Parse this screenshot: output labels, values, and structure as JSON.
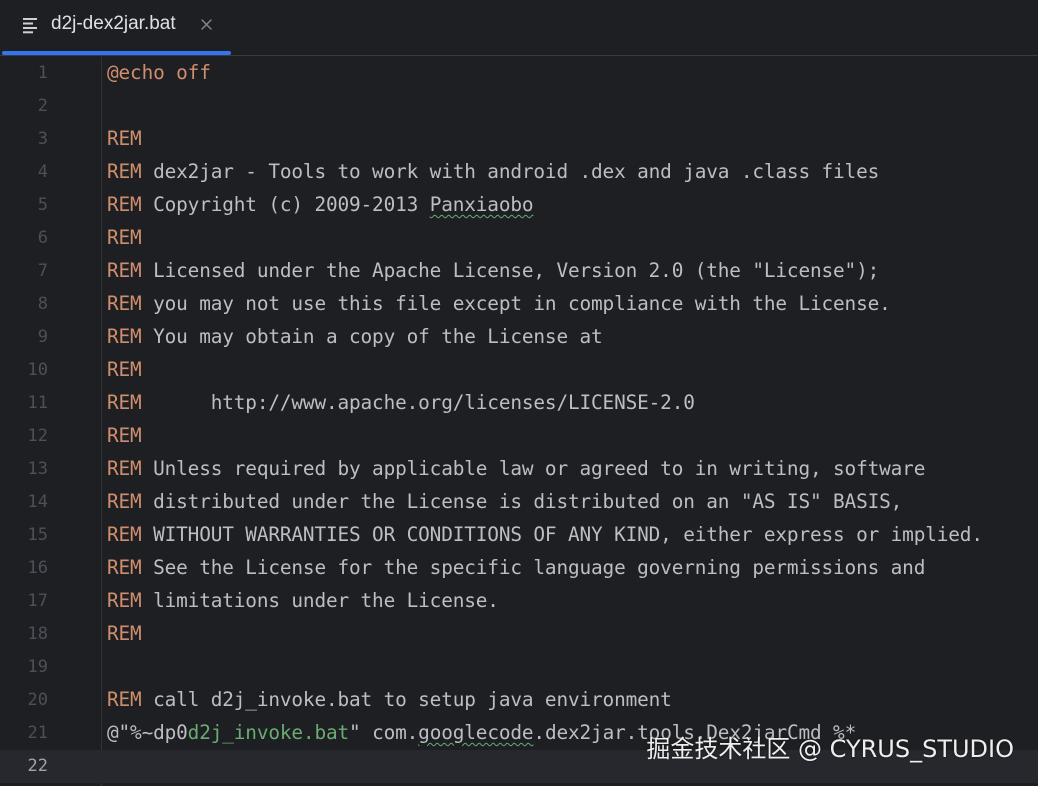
{
  "tab": {
    "label": "d2j-dex2jar.bat",
    "icon": "text-file-icon",
    "close_icon": "close-icon"
  },
  "colors": {
    "background": "#1e1f22",
    "keyword": "#cf8e6d",
    "text": "#bcbec4",
    "string": "#6aab73",
    "line_number": "#4b5059",
    "active_tab_accent": "#3574f0"
  },
  "current_line": 22,
  "lines": [
    {
      "n": "1",
      "tokens": [
        {
          "t": "@echo off",
          "k": "keyword"
        }
      ]
    },
    {
      "n": "2",
      "tokens": []
    },
    {
      "n": "3",
      "tokens": [
        {
          "t": "REM",
          "k": "keyword"
        }
      ]
    },
    {
      "n": "4",
      "tokens": [
        {
          "t": "REM",
          "k": "keyword"
        },
        {
          "t": " dex2jar - Tools to work with android .dex and java .class files",
          "k": "comment"
        }
      ]
    },
    {
      "n": "5",
      "tokens": [
        {
          "t": "REM",
          "k": "keyword"
        },
        {
          "t": " Copyright (c) 2009-2013 ",
          "k": "comment"
        },
        {
          "t": "Panxiaobo",
          "k": "comment-typo"
        }
      ]
    },
    {
      "n": "6",
      "tokens": [
        {
          "t": "REM",
          "k": "keyword"
        }
      ]
    },
    {
      "n": "7",
      "tokens": [
        {
          "t": "REM",
          "k": "keyword"
        },
        {
          "t": " Licensed under the Apache License, Version 2.0 (the \"License\");",
          "k": "comment"
        }
      ]
    },
    {
      "n": "8",
      "tokens": [
        {
          "t": "REM",
          "k": "keyword"
        },
        {
          "t": " you may not use this file except in compliance with the License.",
          "k": "comment"
        }
      ]
    },
    {
      "n": "9",
      "tokens": [
        {
          "t": "REM",
          "k": "keyword"
        },
        {
          "t": " You may obtain a copy of the License at",
          "k": "comment"
        }
      ]
    },
    {
      "n": "10",
      "tokens": [
        {
          "t": "REM",
          "k": "keyword"
        }
      ]
    },
    {
      "n": "11",
      "tokens": [
        {
          "t": "REM",
          "k": "keyword"
        },
        {
          "t": "      http://www.apache.org/licenses/LICENSE-2.0",
          "k": "comment"
        }
      ]
    },
    {
      "n": "12",
      "tokens": [
        {
          "t": "REM",
          "k": "keyword"
        }
      ]
    },
    {
      "n": "13",
      "tokens": [
        {
          "t": "REM",
          "k": "keyword"
        },
        {
          "t": " Unless required by applicable law or agreed to in writing, software",
          "k": "comment"
        }
      ]
    },
    {
      "n": "14",
      "tokens": [
        {
          "t": "REM",
          "k": "keyword"
        },
        {
          "t": " distributed under the License is distributed on an \"AS IS\" BASIS,",
          "k": "comment"
        }
      ]
    },
    {
      "n": "15",
      "tokens": [
        {
          "t": "REM",
          "k": "keyword"
        },
        {
          "t": " WITHOUT WARRANTIES OR CONDITIONS OF ANY KIND, either express or implied.",
          "k": "comment"
        }
      ]
    },
    {
      "n": "16",
      "tokens": [
        {
          "t": "REM",
          "k": "keyword"
        },
        {
          "t": " See the License for the specific language governing permissions and",
          "k": "comment"
        }
      ]
    },
    {
      "n": "17",
      "tokens": [
        {
          "t": "REM",
          "k": "keyword"
        },
        {
          "t": " limitations under the License.",
          "k": "comment"
        }
      ]
    },
    {
      "n": "18",
      "tokens": [
        {
          "t": "REM",
          "k": "keyword"
        }
      ]
    },
    {
      "n": "19",
      "tokens": []
    },
    {
      "n": "20",
      "tokens": [
        {
          "t": "REM",
          "k": "keyword"
        },
        {
          "t": " call d2j_invoke.bat to setup java environment",
          "k": "comment"
        }
      ]
    },
    {
      "n": "21",
      "tokens": [
        {
          "t": "@\"%~dp0",
          "k": "plain"
        },
        {
          "t": "d2j_invoke.bat",
          "k": "string"
        },
        {
          "t": "\" com.",
          "k": "plain"
        },
        {
          "t": "googlecode",
          "k": "plain-typo"
        },
        {
          "t": ".dex2jar.tools.Dex2jarCmd %*",
          "k": "plain"
        }
      ]
    },
    {
      "n": "22",
      "tokens": []
    }
  ],
  "watermark": "掘金技术社区 @ CYRUS_STUDIO"
}
